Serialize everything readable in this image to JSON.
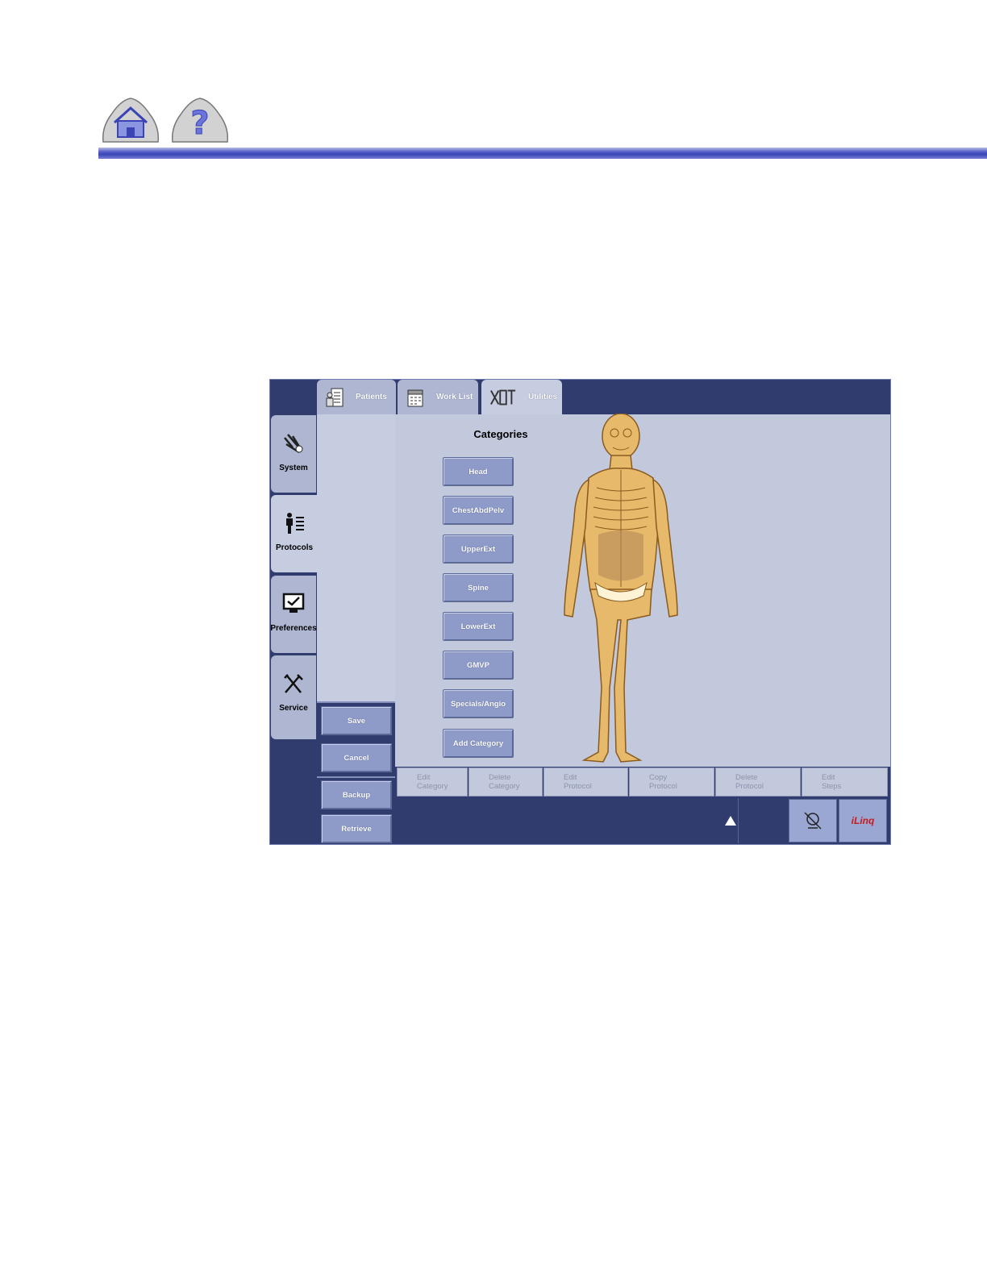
{
  "nav": {
    "home_icon": "home-icon",
    "help_icon": "question-mark-icon",
    "rule_color": "#3a44b5"
  },
  "tabs": [
    {
      "label": "Patients",
      "icon": "patient-chart-icon"
    },
    {
      "label": "Work List",
      "icon": "calendar-icon"
    },
    {
      "label": "Utilities",
      "icon": "tools-icon"
    }
  ],
  "sidebar": {
    "items": [
      {
        "label": "System",
        "icon": "system-tools-icon"
      },
      {
        "label": "Protocols",
        "icon": "protocol-person-icon"
      },
      {
        "label": "Preferences",
        "icon": "monitor-check-icon"
      },
      {
        "label": "Service",
        "icon": "wrench-screwdriver-icon"
      }
    ]
  },
  "categories": {
    "title": "Categories",
    "buttons": [
      "Head",
      "ChestAbdPelv",
      "UpperExt",
      "Spine",
      "LowerExt",
      "GMVP",
      "Specials/Angio",
      "Add Category"
    ]
  },
  "left_buttons": {
    "save": "Save",
    "cancel": "Cancel",
    "backup": "Backup",
    "retrieve": "Retrieve"
  },
  "actions": [
    "Edit\nCategory",
    "Delete\nCategory",
    "Edit\nProtocol",
    "Copy\nProtocol",
    "Delete\nProtocol",
    "Edit\nSteps"
  ],
  "status_bar": {
    "arrow_icon": "up-arrow-icon",
    "no_dose_icon": "no-radiation-icon",
    "iling_label": "iLinq"
  },
  "colors": {
    "app_bg": "#2f3c6d",
    "panel_bg": "#c3c9dc",
    "button_bg": "#8e9bc9",
    "body_fill": "#e7b96a"
  }
}
